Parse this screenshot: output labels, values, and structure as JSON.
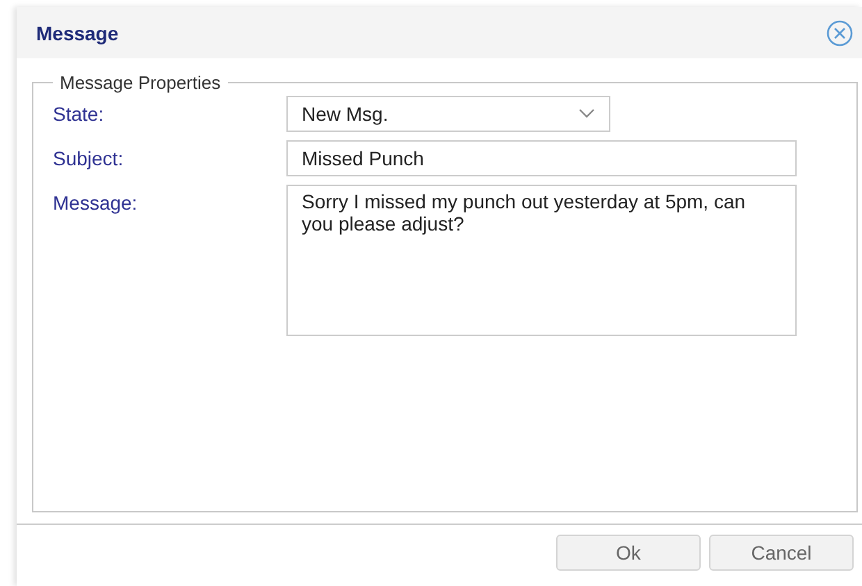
{
  "window": {
    "title": "Message"
  },
  "group": {
    "legend": "Message Properties"
  },
  "fields": [
    {
      "kind": "dropdown",
      "label": "State:",
      "value": "New Msg."
    },
    {
      "kind": "text",
      "label": "Subject:",
      "value": "Missed Punch"
    },
    {
      "kind": "textarea",
      "label": "Message:",
      "value": "Sorry I missed my punch out yesterday at 5pm, can you please adjust?"
    }
  ],
  "buttons": [
    "Ok",
    "Cancel"
  ]
}
